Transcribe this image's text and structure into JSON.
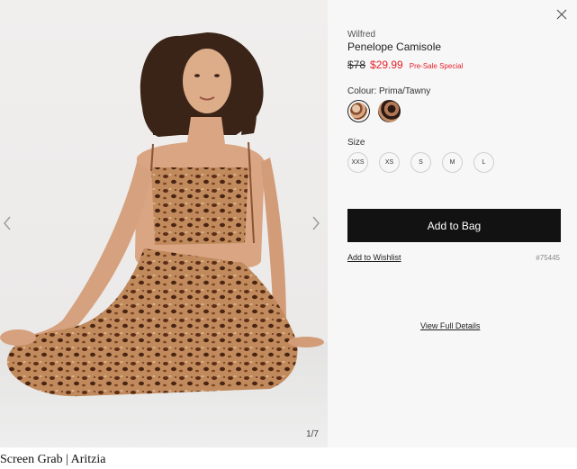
{
  "product_image": {
    "counter": "1/7",
    "prev_icon": "chevron-left-icon",
    "next_icon": "chevron-right-icon"
  },
  "details": {
    "close_icon": "close-icon",
    "brand": "Wilfred",
    "product_name": "Penelope Camisole",
    "price_original": "$78",
    "price_sale": "$29.99",
    "presale_badge": "Pre-Sale Special",
    "colour_label": "Colour: Prima/Tawny",
    "size_label": "Size",
    "sizes": [
      "XXS",
      "XS",
      "S",
      "M",
      "L"
    ],
    "add_to_bag_label": "Add to Bag",
    "wishlist_label": "Add to Wishlist",
    "sku": "#75445",
    "full_details_label": "View Full Details"
  },
  "colors": {
    "sale_red": "#e8202a",
    "button_black": "#121212",
    "panel_bg": "#f7f7f7"
  },
  "caption": "Screen Grab | Aritzia"
}
